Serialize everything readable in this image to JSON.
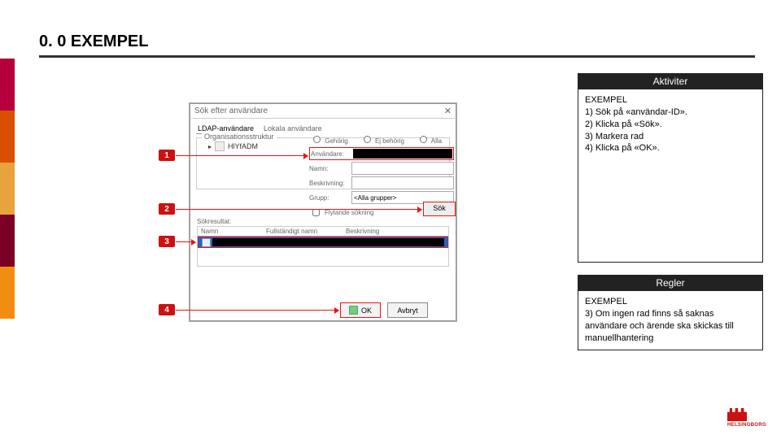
{
  "title": "0. 0 EXEMPEL",
  "sidebar_colors": [
    "#b5003c",
    "#b5003c",
    "#d94f00",
    "#d94f00",
    "#e8a33d",
    "#e8a33d",
    "#7a0026",
    "#7a0026",
    "#f18e11",
    "#f18e11"
  ],
  "boxes": {
    "aktiviter": {
      "header": "Aktiviter",
      "lines": [
        "EXEMPEL",
        "1) Sök på «användar-ID».",
        "2) Klicka på «Sök».",
        "3) Markera rad",
        "4) Klicka på «OK»."
      ]
    },
    "regler": {
      "header": "Regler",
      "lines": [
        "EXEMPEL",
        "3) Om ingen rad finns så saknas användare och ärende ska skickas till manuellhantering"
      ]
    }
  },
  "dialog": {
    "title": "Sök efter användare",
    "tabs": [
      "LDAP-användare",
      "Lokala användare"
    ],
    "panel_label": "Organisationsstruktur",
    "tree_item": "HlYfADM",
    "checks": [
      "Gehörig",
      "Ej behörig",
      "Alla"
    ],
    "form": {
      "f1": "Användare:",
      "f2": "Namn:",
      "f3": "Beskrivning:",
      "f4": "Grupp:",
      "grupp_value": "<Alla grupper>",
      "flyt": "Flytande sökning"
    },
    "sok_btn": "Sök",
    "sokres": "Sökresultat:",
    "cols": [
      "Namn",
      "Fullständigt namn",
      "Beskrivning"
    ],
    "ok": "OK",
    "avbryt": "Avbryt"
  },
  "markers": [
    "1",
    "2",
    "3",
    "4"
  ],
  "logo": "HELSINGBORG"
}
